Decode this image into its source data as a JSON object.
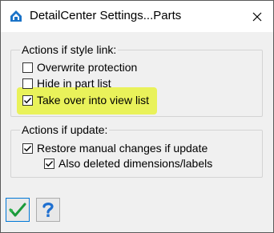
{
  "window": {
    "title": "DetailCenter Settings...Parts"
  },
  "style_link_group": {
    "legend": "Actions if style link:",
    "options": [
      {
        "label": "Overwrite protection",
        "checked": false
      },
      {
        "label": "Hide in part list",
        "checked": false
      },
      {
        "label": "Take over into view list",
        "checked": true,
        "highlighted": true
      }
    ]
  },
  "update_group": {
    "legend": "Actions if update:",
    "options": [
      {
        "label": "Restore manual changes if update",
        "checked": true
      },
      {
        "label": "Also deleted dimensions/labels",
        "checked": true
      }
    ]
  },
  "toolbar": {
    "ok_icon": "green-checkmark-icon",
    "help_icon": "question-mark-icon"
  },
  "colors": {
    "highlight": "#e9f25a",
    "ok_green": "#1a9a3a",
    "help_blue": "#1e6fd0"
  }
}
